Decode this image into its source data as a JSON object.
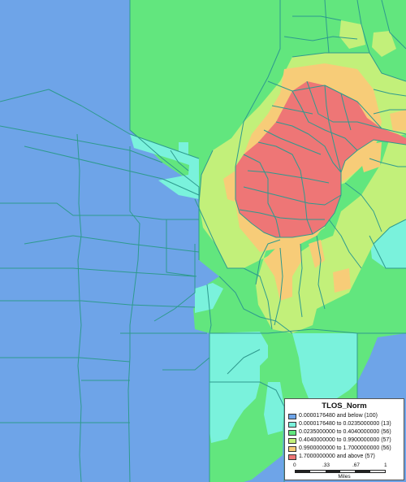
{
  "legend": {
    "title": "TLOS_Norm",
    "classes": [
      {
        "label": "0.0000176480 and below (100)",
        "color": "#6ea4e8"
      },
      {
        "label": "0.0000176480 to 0.0235000000 (13)",
        "color": "#7af2dc"
      },
      {
        "label": "0.0235000000 to 0.4040000000 (56)",
        "color": "#62e67e"
      },
      {
        "label": "0.4040000000 to 0.9900000000 (57)",
        "color": "#c2f07a"
      },
      {
        "label": "0.9900000000 to 1.7000000000 (56)",
        "color": "#f7cc78"
      },
      {
        "label": "1.7000000000 and above (57)",
        "color": "#ee7676"
      }
    ],
    "scale_ticks": [
      "0",
      ".33",
      ".67",
      "1"
    ],
    "scale_unit": "Miles"
  }
}
